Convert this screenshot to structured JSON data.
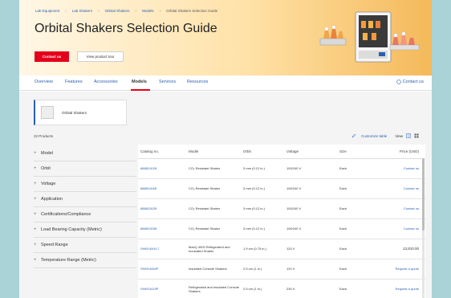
{
  "breadcrumb": [
    "Lab Equipment",
    "Lab Shakers",
    "Orbital Shakers",
    "Models",
    "Orbital Shakers Selection Guide"
  ],
  "page_title": "Orbital Shakers Selection Guide",
  "hero_buttons": {
    "contact": "Contact us",
    "tour": "View product tour"
  },
  "nav": {
    "tabs": [
      "Overview",
      "Features",
      "Accessories",
      "Models",
      "Services",
      "Resources"
    ],
    "active": "Models",
    "contact": "Contact us"
  },
  "category_card": {
    "label": "Orbital Shakers"
  },
  "results_count": "22 Products",
  "toolbar": {
    "customize": "Customize table",
    "view": "View"
  },
  "filters": [
    "Model",
    "Orbit",
    "Voltage",
    "Application",
    "Certifications/Compliance",
    "Load Bearing Capacity (Metric)",
    "Speed Range",
    "Temperature Range (Metric)"
  ],
  "table": {
    "headers": [
      "Catalog no.",
      "Model",
      "Orbit",
      "Voltage",
      "Size",
      "Price (USD)"
    ],
    "rows": [
      [
        "88881101B",
        "CO₂ Resistant Shaker",
        "3 mm (0.12 in.)",
        "100/240 V",
        "Each",
        "Contact us"
      ],
      [
        "88881104B",
        "CO₂ Resistant Shaker",
        "3 mm (0.12 in.)",
        "100/240 V",
        "Each",
        "Contact us"
      ],
      [
        "88881102B",
        "CO₂ Resistant Shaker",
        "3 mm (0.12 in.)",
        "100/240 V",
        "Each",
        "Contact us"
      ],
      [
        "88881103B",
        "CO₂ Resistant Shaker",
        "3 mm (0.12 in.)",
        "100/240 V",
        "Each",
        "Contact us"
      ],
      [
        "SHKE4000-7",
        "MaxQ 4000 Refrigerated and Incubated Shaker",
        "1.9 cm (0.75 in.)",
        "120 V",
        "Each",
        "13,810.00"
      ],
      [
        "SHKE4450P",
        "Insulated Console Shakers",
        "2.5 cm (1 in.)",
        "120 V",
        "Each",
        "Request a quote"
      ],
      [
        "SHKE4415P",
        "Refrigerated and Insulated Console Shakers",
        "2.5 cm (1 in.)",
        "230 V",
        "Each",
        "Request a quote"
      ]
    ]
  },
  "colors": {
    "brand_red": "#e3001b",
    "link_blue": "#2a5fb0",
    "hero_orange": "#f4b95a"
  }
}
